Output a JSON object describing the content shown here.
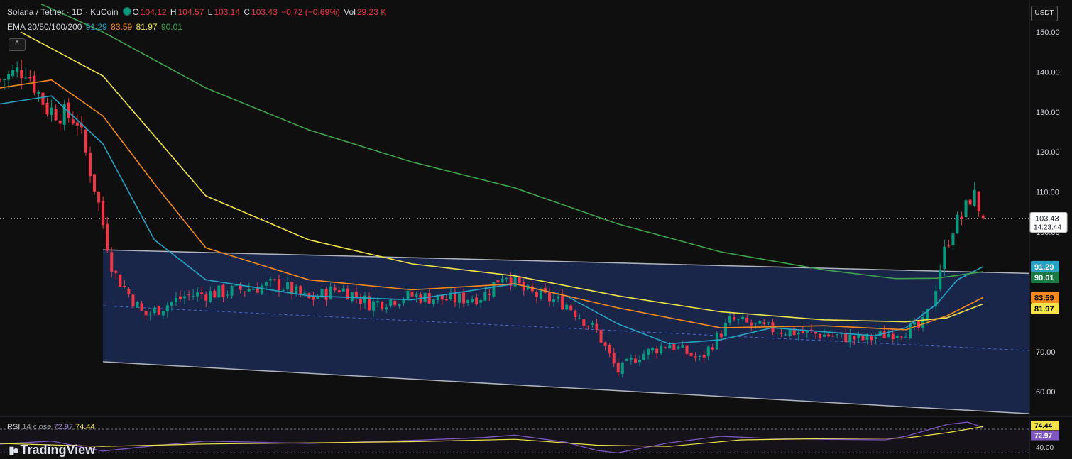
{
  "header": {
    "symbol": "Solana / Tether · 1D · KuCoin",
    "o_label": "O",
    "o": "104.12",
    "h_label": "H",
    "h": "104.57",
    "l_label": "L",
    "l": "103.14",
    "c_label": "C",
    "c": "103.43",
    "change": "−0.72 (−0.69%)",
    "vol_label": "Vol",
    "vol": "29.23 K",
    "ema_label": "EMA 20/50/100/200",
    "ema20": "91.29",
    "ema50": "83.59",
    "ema100": "81.97",
    "ema200": "90.01"
  },
  "currency_button": "USDT",
  "collapse_icon": "^",
  "price_tag": {
    "value": "103.43",
    "countdown": "14:23:44"
  },
  "ema_tags": [
    {
      "value": "91.29",
      "price": 91.29,
      "bg": "#26a3c4",
      "fg": "#ffffff"
    },
    {
      "value": "90.01",
      "price": 88.6,
      "bg": "#1e7a45",
      "fg": "#ffffff"
    },
    {
      "value": "83.59",
      "price": 83.59,
      "bg": "#f48a1e",
      "fg": "#000000"
    },
    {
      "value": "81.97",
      "price": 80.8,
      "bg": "#f2e349",
      "fg": "#000000"
    }
  ],
  "rsi": {
    "label": "RSI",
    "params": "14 close",
    "value": "72.97",
    "ma": "74.44",
    "tag_rsi": "72.97",
    "tag_ma": "74.44",
    "tick": "40.00"
  },
  "logo": {
    "icon": "tradingview-logo-icon",
    "text": "TradingView"
  },
  "colors": {
    "background": "#0f0f0f",
    "up": "#089981",
    "down": "#f23645",
    "ema20": "#26a3c4",
    "ema50": "#f48a1e",
    "ema100": "#f2e349",
    "ema200": "#3fa34d",
    "channel_fill": "#1b2a55",
    "channel_line": "#b2b5be",
    "rsi_line": "#7e57c2",
    "rsi_ma": "#f2e349"
  },
  "chart_data": {
    "type": "candlestick",
    "title": "Solana / Tether · 1D · KuCoin",
    "ylim": [
      54,
      158
    ],
    "y_ticks": [
      "150.00",
      "140.00",
      "130.00",
      "120.00",
      "110.00",
      "100.00",
      "70.00",
      "60.00"
    ],
    "current_price": 103.43,
    "channel": {
      "upper": [
        [
          0.1,
          95.5
        ],
        [
          1.0,
          89.6
        ]
      ],
      "lower": [
        [
          0.1,
          67.5
        ],
        [
          1.0,
          54.5
        ]
      ],
      "mid": [
        [
          0.1,
          81.5
        ],
        [
          1.0,
          70.3
        ]
      ]
    },
    "close_path": [
      [
        0.0,
        138
      ],
      [
        0.025,
        141
      ],
      [
        0.045,
        131
      ],
      [
        0.075,
        128
      ],
      [
        0.095,
        108
      ],
      [
        0.11,
        90
      ],
      [
        0.14,
        79
      ],
      [
        0.18,
        84
      ],
      [
        0.22,
        85
      ],
      [
        0.27,
        87
      ],
      [
        0.3,
        83
      ],
      [
        0.33,
        86
      ],
      [
        0.36,
        82
      ],
      [
        0.4,
        84
      ],
      [
        0.44,
        83
      ],
      [
        0.47,
        84
      ],
      [
        0.49,
        90
      ],
      [
        0.51,
        85
      ],
      [
        0.55,
        82
      ],
      [
        0.58,
        75
      ],
      [
        0.6,
        65
      ],
      [
        0.62,
        69
      ],
      [
        0.65,
        72
      ],
      [
        0.68,
        68
      ],
      [
        0.71,
        78
      ],
      [
        0.74,
        76
      ],
      [
        0.77,
        75
      ],
      [
        0.81,
        74
      ],
      [
        0.84,
        73
      ],
      [
        0.87,
        75
      ],
      [
        0.895,
        76
      ],
      [
        0.905,
        82
      ],
      [
        0.915,
        93
      ],
      [
        0.925,
        101
      ],
      [
        0.935,
        104
      ],
      [
        0.945,
        110
      ],
      [
        0.955,
        103.4
      ]
    ],
    "series": [
      {
        "name": "EMA 20",
        "points": [
          [
            0.0,
            132
          ],
          [
            0.05,
            134
          ],
          [
            0.1,
            122
          ],
          [
            0.15,
            98
          ],
          [
            0.2,
            88
          ],
          [
            0.3,
            84
          ],
          [
            0.4,
            83
          ],
          [
            0.5,
            87
          ],
          [
            0.55,
            84
          ],
          [
            0.6,
            77
          ],
          [
            0.65,
            72
          ],
          [
            0.7,
            73
          ],
          [
            0.75,
            76
          ],
          [
            0.85,
            74
          ],
          [
            0.88,
            76
          ],
          [
            0.91,
            82
          ],
          [
            0.93,
            88
          ],
          [
            0.955,
            91.29
          ]
        ]
      },
      {
        "name": "EMA 50",
        "points": [
          [
            0.0,
            136
          ],
          [
            0.05,
            138
          ],
          [
            0.1,
            129
          ],
          [
            0.15,
            112
          ],
          [
            0.2,
            96
          ],
          [
            0.3,
            88
          ],
          [
            0.4,
            85.5
          ],
          [
            0.5,
            87
          ],
          [
            0.6,
            81
          ],
          [
            0.7,
            76
          ],
          [
            0.8,
            76.5
          ],
          [
            0.88,
            75.5
          ],
          [
            0.92,
            79
          ],
          [
            0.955,
            83.59
          ]
        ]
      },
      {
        "name": "EMA 100",
        "points": [
          [
            0.02,
            150
          ],
          [
            0.1,
            139
          ],
          [
            0.15,
            124
          ],
          [
            0.2,
            109
          ],
          [
            0.3,
            98
          ],
          [
            0.4,
            92
          ],
          [
            0.5,
            89
          ],
          [
            0.6,
            84
          ],
          [
            0.7,
            80
          ],
          [
            0.8,
            78
          ],
          [
            0.88,
            77.5
          ],
          [
            0.92,
            78.5
          ],
          [
            0.955,
            81.97
          ]
        ]
      },
      {
        "name": "EMA 200",
        "points": [
          [
            0.04,
            157
          ],
          [
            0.1,
            150
          ],
          [
            0.2,
            136
          ],
          [
            0.3,
            125.5
          ],
          [
            0.4,
            117.5
          ],
          [
            0.5,
            111
          ],
          [
            0.6,
            102
          ],
          [
            0.7,
            95
          ],
          [
            0.8,
            90.5
          ],
          [
            0.87,
            88.3
          ],
          [
            0.91,
            88.4
          ],
          [
            0.955,
            90.01
          ]
        ]
      }
    ],
    "rsi": {
      "levels": [
        70,
        30
      ],
      "line": [
        [
          0.0,
          45
        ],
        [
          0.05,
          50
        ],
        [
          0.1,
          33
        ],
        [
          0.15,
          42
        ],
        [
          0.2,
          50
        ],
        [
          0.3,
          46
        ],
        [
          0.4,
          51
        ],
        [
          0.47,
          56
        ],
        [
          0.5,
          60
        ],
        [
          0.55,
          48
        ],
        [
          0.58,
          34
        ],
        [
          0.6,
          30
        ],
        [
          0.65,
          47
        ],
        [
          0.7,
          58
        ],
        [
          0.74,
          55
        ],
        [
          0.8,
          53
        ],
        [
          0.86,
          52
        ],
        [
          0.88,
          58
        ],
        [
          0.9,
          68
        ],
        [
          0.92,
          78
        ],
        [
          0.94,
          82
        ],
        [
          0.955,
          72.97
        ]
      ],
      "ma": [
        [
          0.0,
          46
        ],
        [
          0.1,
          41
        ],
        [
          0.2,
          45
        ],
        [
          0.3,
          47
        ],
        [
          0.4,
          49
        ],
        [
          0.5,
          53
        ],
        [
          0.58,
          43
        ],
        [
          0.65,
          41
        ],
        [
          0.72,
          52
        ],
        [
          0.8,
          54
        ],
        [
          0.88,
          55
        ],
        [
          0.92,
          64
        ],
        [
          0.955,
          74.44
        ]
      ]
    }
  }
}
